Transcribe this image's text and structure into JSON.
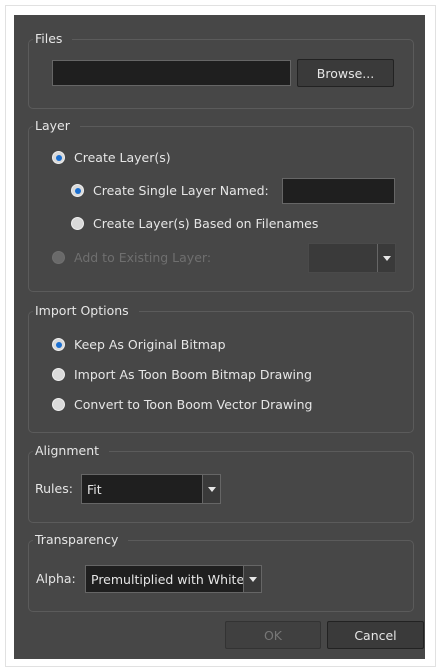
{
  "files": {
    "title": "Files",
    "path_value": "",
    "browse_label": "Browse..."
  },
  "layer": {
    "title": "Layer",
    "create_layers_label": "Create Layer(s)",
    "create_single_label": "Create Single Layer Named:",
    "single_name_value": "",
    "based_on_filenames_label": "Create Layer(s) Based on Filenames",
    "add_existing_label": "Add to Existing Layer:",
    "existing_layer_value": ""
  },
  "import_options": {
    "title": "Import Options",
    "keep_original_label": "Keep As Original Bitmap",
    "import_bitmap_label": "Import As Toon Boom Bitmap Drawing",
    "convert_vector_label": "Convert to Toon Boom Vector Drawing"
  },
  "alignment": {
    "title": "Alignment",
    "rules_label": "Rules:",
    "rules_value": "Fit"
  },
  "transparency": {
    "title": "Transparency",
    "alpha_label": "Alpha:",
    "alpha_value": "Premultiplied with White"
  },
  "footer": {
    "ok_label": "OK",
    "cancel_label": "Cancel"
  }
}
